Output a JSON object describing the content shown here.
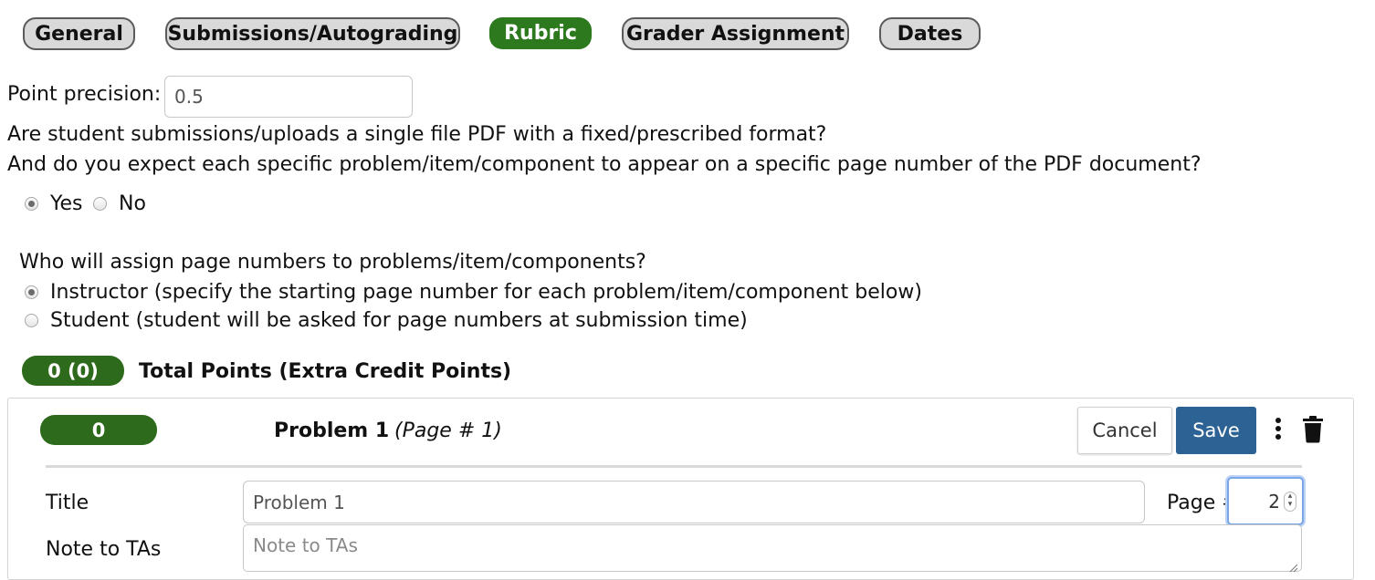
{
  "tabs": [
    {
      "label": "General"
    },
    {
      "label": "Submissions/Autograding"
    },
    {
      "label": "Rubric"
    },
    {
      "label": "Grader Assignment"
    },
    {
      "label": "Dates"
    }
  ],
  "precision": {
    "label": "Point precision:",
    "value": "0.5"
  },
  "pdf_question": {
    "line1": "Are student submissions/uploads a single file PDF with a fixed/prescribed format?",
    "line2": "And do you expect each specific problem/item/component to appear on a specific page number of the PDF document?",
    "yes": "Yes",
    "no": "No"
  },
  "page_assign": {
    "question": "Who will assign page numbers to problems/item/components?",
    "instructor": "Instructor (specify the starting page number for each problem/item/component below)",
    "student": "Student (student will be asked for page numbers at submission time)"
  },
  "totals": {
    "badge": "0 (0)",
    "label": "Total Points (Extra Credit Points)"
  },
  "problem": {
    "points_badge": "0",
    "title": "Problem 1",
    "page_note": "(Page # 1)",
    "cancel": "Cancel",
    "save": "Save",
    "title_label": "Title",
    "title_value": "Problem 1",
    "page_label": "Page #",
    "page_value": "2",
    "note_label": "Note to TAs",
    "note_placeholder": "Note to TAs"
  },
  "colors": {
    "accent_green": "#2d7a1e",
    "save_blue": "#2c6294"
  }
}
